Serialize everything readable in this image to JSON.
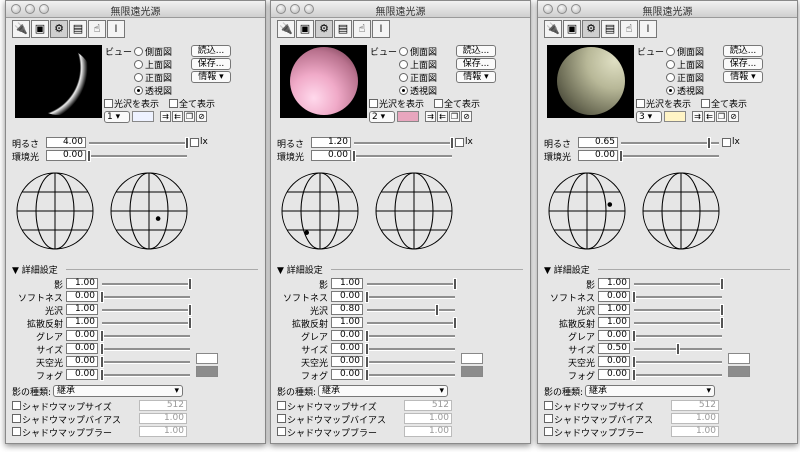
{
  "panels": [
    {
      "title": "無限遠光源",
      "view_label": "ビュー",
      "views": [
        "側面図",
        "上面図",
        "正面図",
        "透視図"
      ],
      "selected_view": 3,
      "buttons": {
        "load": "読込...",
        "save": "保存...",
        "info": "情報 ▾"
      },
      "show_gloss": "光沢を表示",
      "show_all": "全て表示",
      "light_index": "1 ▾",
      "light_color": "#eef2ff",
      "sphere_style": "radial-gradient(circle at 10% 30%, #000 62%, #eee 64%, #000 72%)",
      "brightness": {
        "label": "明るさ",
        "value": "4.00",
        "level": 1.0,
        "lx": "lx"
      },
      "ambient": {
        "label": "環境光",
        "value": "0.00",
        "level": 0.0
      },
      "globe_dot": {
        "globe": 2,
        "dx": 0.24,
        "dy": 0.2
      },
      "detail": "▼ 詳細設定",
      "params": [
        {
          "label": "影",
          "value": "1.00",
          "level": 1.0
        },
        {
          "label": "ソフトネス",
          "value": "0.00",
          "level": 0.0
        },
        {
          "label": "光沢",
          "value": "1.00",
          "level": 1.0
        },
        {
          "label": "拡散反射",
          "value": "1.00",
          "level": 1.0
        },
        {
          "label": "グレア",
          "value": "0.00",
          "level": 0.0
        },
        {
          "label": "サイズ",
          "value": "0.00",
          "level": 0.0
        },
        {
          "label": "天空光",
          "value": "0.00",
          "level": 0.0
        },
        {
          "label": "フォグ",
          "value": "0.00",
          "level": 0.0
        }
      ],
      "sky_color": "#ffffff",
      "fog_color": "#8c8c8c",
      "shadow_type_label": "影の種類:",
      "shadow_type_value": "継承",
      "shadow_rows": [
        {
          "label": "シャドウマップサイズ",
          "value": "512"
        },
        {
          "label": "シャドウマップバイアス",
          "value": "1.00"
        },
        {
          "label": "シャドウマップブラー",
          "value": "1.00"
        }
      ]
    },
    {
      "title": "無限遠光源",
      "view_label": "ビュー",
      "views": [
        "側面図",
        "上面図",
        "正面図",
        "透視図"
      ],
      "selected_view": 3,
      "buttons": {
        "load": "読込...",
        "save": "保存...",
        "info": "情報 ▾"
      },
      "show_gloss": "光沢を表示",
      "show_all": "全て表示",
      "light_index": "2 ▾",
      "light_color": "#e8a6be",
      "sphere_style": "radial-gradient(circle at 35% 75%, #ffd9ec 0%, #f0aac8 35%, #b9728e 70%, #5a2a3c 100%)",
      "brightness": {
        "label": "明るさ",
        "value": "1.20",
        "level": 1.0,
        "lx": "lx"
      },
      "ambient": {
        "label": "環境光",
        "value": "0.00",
        "level": 0.0
      },
      "globe_dot": {
        "globe": 1,
        "dx": -0.35,
        "dy": 0.57
      },
      "detail": "▼ 詳細設定",
      "params": [
        {
          "label": "影",
          "value": "1.00",
          "level": 1.0
        },
        {
          "label": "ソフトネス",
          "value": "0.00",
          "level": 0.0
        },
        {
          "label": "光沢",
          "value": "0.80",
          "level": 0.8
        },
        {
          "label": "拡散反射",
          "value": "1.00",
          "level": 1.0
        },
        {
          "label": "グレア",
          "value": "0.00",
          "level": 0.0
        },
        {
          "label": "サイズ",
          "value": "0.00",
          "level": 0.0
        },
        {
          "label": "天空光",
          "value": "0.00",
          "level": 0.0
        },
        {
          "label": "フォグ",
          "value": "0.00",
          "level": 0.0
        }
      ],
      "sky_color": "#ffffff",
      "fog_color": "#8c8c8c",
      "shadow_type_label": "影の種類:",
      "shadow_type_value": "継承",
      "shadow_rows": [
        {
          "label": "シャドウマップサイズ",
          "value": "512"
        },
        {
          "label": "シャドウマップバイアス",
          "value": "1.00"
        },
        {
          "label": "シャドウマップブラー",
          "value": "1.00"
        }
      ]
    },
    {
      "title": "無限遠光源",
      "view_label": "ビュー",
      "views": [
        "側面図",
        "上面図",
        "正面図",
        "透視図"
      ],
      "selected_view": 3,
      "buttons": {
        "load": "読込...",
        "save": "保存...",
        "info": "情報 ▾"
      },
      "show_gloss": "光沢を表示",
      "show_all": "全て表示",
      "light_index": "3 ▾",
      "light_color": "#fff4c6",
      "sphere_style": "radial-gradient(circle at 85% 20%, #e0e0c4 0%, #b8b898 35%, #6f6f58 70%, #2a2a20 100%)",
      "brightness": {
        "label": "明るさ",
        "value": "0.65",
        "level": 0.9,
        "lx": "lx"
      },
      "ambient": {
        "label": "環境光",
        "value": "0.00",
        "level": 0.0
      },
      "globe_dot": {
        "globe": 1,
        "dx": 0.6,
        "dy": -0.17
      },
      "detail": "▼ 詳細設定",
      "params": [
        {
          "label": "影",
          "value": "1.00",
          "level": 1.0
        },
        {
          "label": "ソフトネス",
          "value": "0.00",
          "level": 0.0
        },
        {
          "label": "光沢",
          "value": "1.00",
          "level": 1.0
        },
        {
          "label": "拡散反射",
          "value": "1.00",
          "level": 1.0
        },
        {
          "label": "グレア",
          "value": "0.00",
          "level": 0.0
        },
        {
          "label": "サイズ",
          "value": "0.50",
          "level": 0.5
        },
        {
          "label": "天空光",
          "value": "0.00",
          "level": 0.0
        },
        {
          "label": "フォグ",
          "value": "0.00",
          "level": 0.0
        }
      ],
      "sky_color": "#ffffff",
      "fog_color": "#8c8c8c",
      "shadow_type_label": "影の種類:",
      "shadow_type_value": "継承",
      "shadow_rows": [
        {
          "label": "シャドウマップサイズ",
          "value": "512"
        },
        {
          "label": "シャドウマップバイアス",
          "value": "1.00"
        },
        {
          "label": "シャドウマップブラー",
          "value": "1.00"
        }
      ]
    }
  ]
}
